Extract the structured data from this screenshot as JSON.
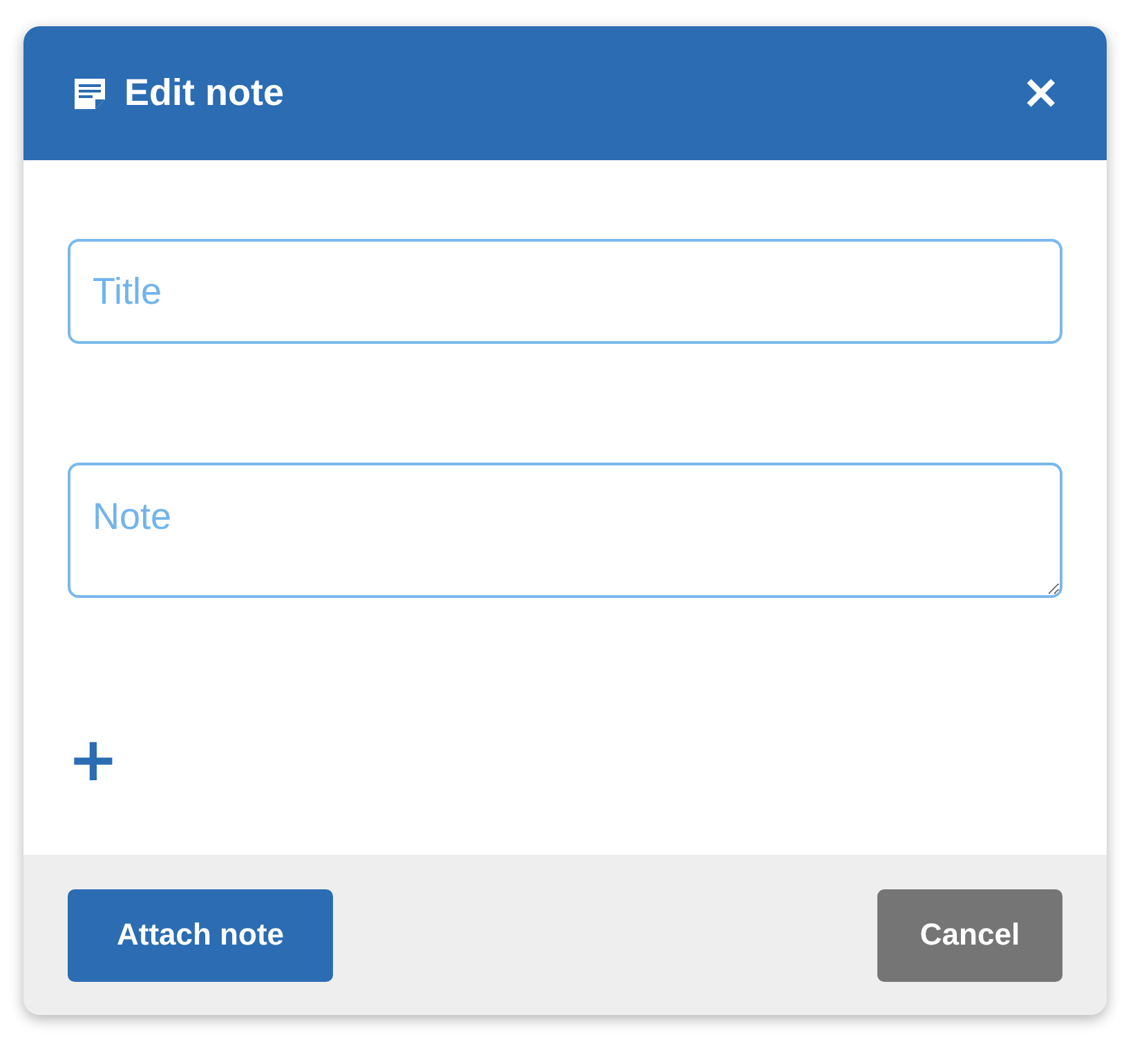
{
  "dialog": {
    "title": "Edit note",
    "close": "✕"
  },
  "fields": [
    {
      "kind": "input",
      "placeholder": "Title"
    },
    {
      "kind": "textarea",
      "placeholder": "Note"
    }
  ],
  "add": "+",
  "buttons": [
    {
      "label": "Attach note",
      "kind": "primary"
    },
    {
      "label": "Cancel",
      "kind": "secondary"
    }
  ]
}
